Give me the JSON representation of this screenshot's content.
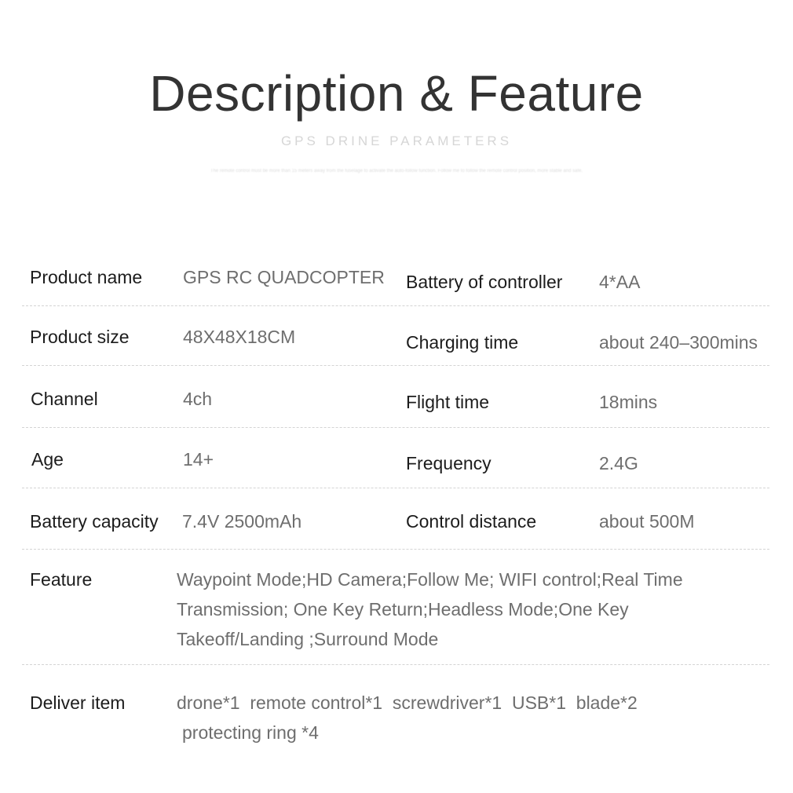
{
  "header": {
    "title": "Description & Feature",
    "subtitle": "GPS DRINE PARAMETERS",
    "blurb": "The remote control must be more than 15 meters away from the fuselage to activate the auto-follow function. Follow me to follow the remote control position, more stable and safe."
  },
  "specs": {
    "product_name": {
      "label": "Product name",
      "value": "GPS RC QUADCOPTER"
    },
    "battery_of_controller": {
      "label": "Battery of controller",
      "value": "4*AA"
    },
    "product_size": {
      "label": "Product size",
      "value": "48X48X18CM"
    },
    "charging_time": {
      "label": "Charging time",
      "value": "about 240–300mins"
    },
    "channel": {
      "label": "Channel",
      "value": "4ch"
    },
    "flight_time": {
      "label": "Flight time",
      "value": "18mins"
    },
    "age": {
      "label": "Age",
      "value": "14+"
    },
    "frequency": {
      "label": "Frequency",
      "value": "2.4G"
    },
    "battery_capacity": {
      "label": "Battery capacity",
      "value": "7.4V 2500mAh"
    },
    "control_distance": {
      "label": "Control distance",
      "value": "about 500M"
    },
    "feature": {
      "label": "Feature",
      "value": "Waypoint Mode;HD Camera;Follow Me; WIFI control;Real Time Transmission; One Key Return;Headless Mode;One Key Takeoff/Landing ;Surround Mode"
    },
    "deliver_item": {
      "label": "Deliver item",
      "value_line1": "drone*1  remote control*1  screwdriver*1  USB*1  blade*2",
      "value_line2": "protecting ring *4"
    }
  }
}
